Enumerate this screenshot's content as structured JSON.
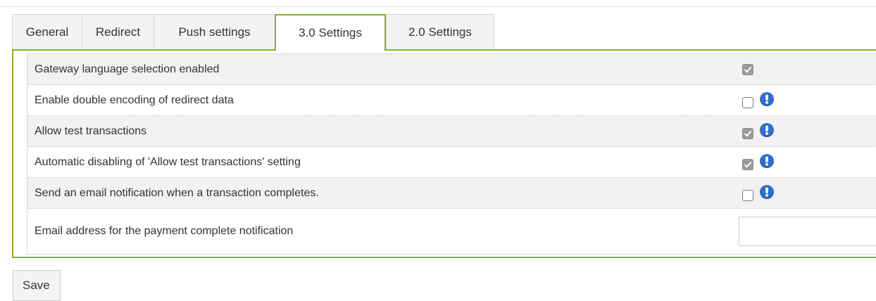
{
  "tabs": [
    {
      "label": "General",
      "active": false
    },
    {
      "label": "Redirect",
      "active": false
    },
    {
      "label": "Push settings",
      "active": false
    },
    {
      "label": "3.0 Settings",
      "active": true
    },
    {
      "label": "2.0 Settings",
      "active": false
    }
  ],
  "settings": [
    {
      "label": "Gateway language selection enabled",
      "checked": true,
      "info_icon": false
    },
    {
      "label": "Enable double encoding of redirect data",
      "checked": false,
      "info_icon": true
    },
    {
      "label": "Allow test transactions",
      "checked": true,
      "info_icon": true
    },
    {
      "label": "Automatic disabling of 'Allow test transactions' setting",
      "checked": true,
      "info_icon": true
    },
    {
      "label": "Send an email notification when a transaction completes.",
      "checked": false,
      "info_icon": true
    }
  ],
  "email_setting": {
    "label": "Email address for the payment complete notification",
    "value": ""
  },
  "save_label": "Save",
  "colors": {
    "accent": "#8aaf2a",
    "info": "#2d6fd1",
    "checked_box": "#9c9c9c"
  },
  "icons": {
    "info": "exclamation-info-icon",
    "check": "checkmark-icon"
  }
}
